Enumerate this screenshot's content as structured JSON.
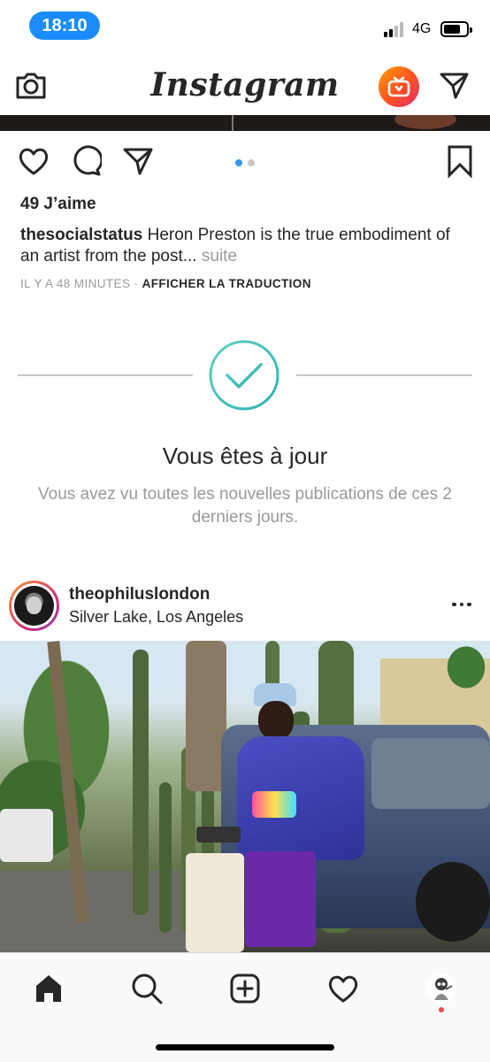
{
  "status_bar": {
    "time": "18:10",
    "network": "4G"
  },
  "top_nav": {
    "logo": "Instagram"
  },
  "post": {
    "likes": "49 J’aime",
    "caption_user": "thesocialstatus",
    "caption_text": " Heron Preston is the true embodiment of an artist from the post",
    "caption_ellipsis": "... ",
    "caption_more": "suite",
    "time_ago": "IL Y A 48 MINUTES",
    "separator": " · ",
    "translate_label": "AFFICHER LA TRADUCTION",
    "carousel_index": 1,
    "carousel_count": 2
  },
  "caught_up": {
    "title": "Vous êtes à jour",
    "subtitle": "Vous avez vu toutes les nouvelles publications de ces 2 derniers jours."
  },
  "next_post": {
    "username": "theophiluslondon",
    "location": "Silver Lake, Los Angeles"
  },
  "colors": {
    "accent": "#3897f0",
    "time_pill": "#1a8cff",
    "check_gradient_start": "#5fd0c1",
    "check_gradient_end": "#2bb0b8",
    "notification": "#ed4956"
  },
  "icons": {
    "camera": "camera-icon",
    "igtv": "igtv-icon",
    "direct": "direct-message-icon",
    "like": "heart-icon",
    "comment": "comment-icon",
    "share": "send-icon",
    "save": "bookmark-icon",
    "more": "more-dots-icon",
    "home": "home-icon",
    "search": "search-icon",
    "new_post": "add-post-icon",
    "activity": "heart-icon",
    "profile": "profile-avatar"
  }
}
